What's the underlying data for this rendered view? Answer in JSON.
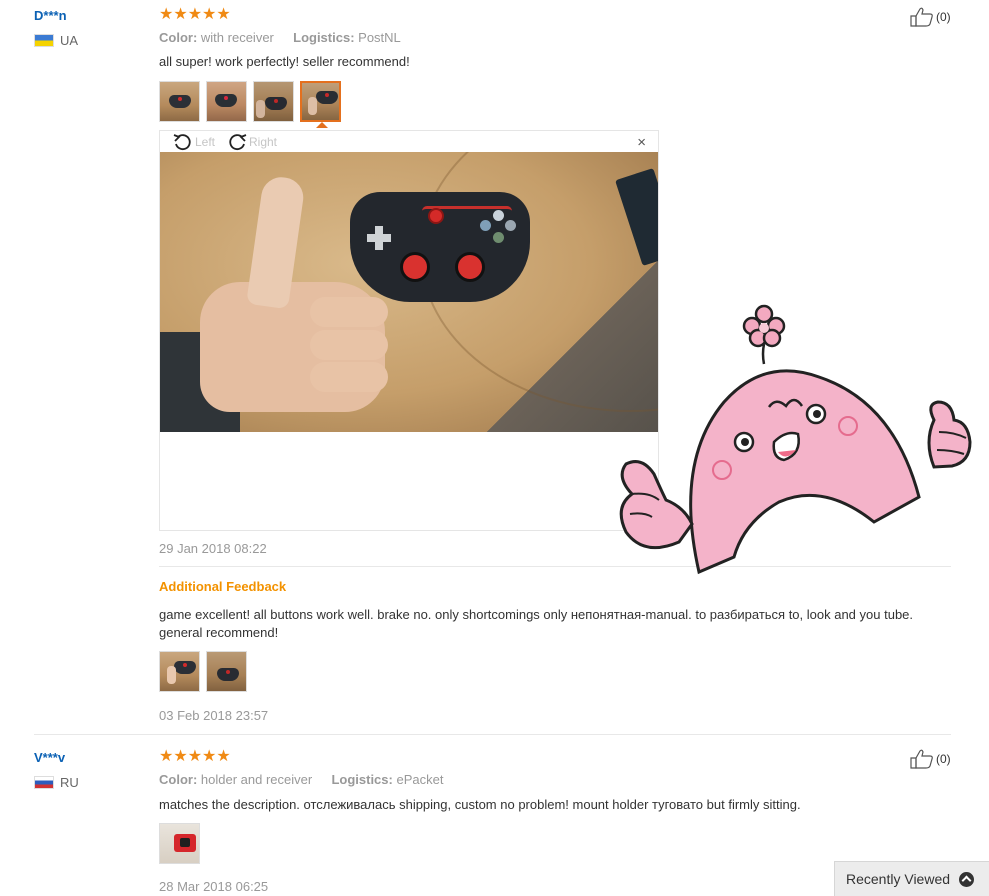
{
  "reviews": [
    {
      "user": "D***n",
      "country": "UA",
      "stars": "★★★★★",
      "rating": 5,
      "color_label": "Color:",
      "color_value": "with receiver",
      "logistics_label": "Logistics:",
      "logistics_value": "PostNL",
      "text": "all super! work perfectly! seller recommend!",
      "helpful_count": "(0)",
      "date": "29 Jan 2018 08:22",
      "viewer": {
        "rotate_left": "Left",
        "rotate_right": "Right",
        "close": "×"
      },
      "additional": {
        "title": "Additional Feedback",
        "text": "game excellent! all buttons work well. brake no. only shortcomings only непонятная-manual. to разбираться to, look and you tube. general recommend!",
        "date": "03 Feb 2018 23:57"
      }
    },
    {
      "user": "V***v",
      "country": "RU",
      "stars": "★★★★★",
      "rating": 5,
      "color_label": "Color:",
      "color_value": "holder and receiver",
      "logistics_label": "Logistics:",
      "logistics_value": "ePacket",
      "text": "matches the description. отслеживалась shipping, custom no problem! mount holder туговато but firmly sitting.",
      "helpful_count": "(0)",
      "date": "28 Mar 2018 06:25"
    }
  ],
  "recently_viewed": "Recently Viewed",
  "colors": {
    "accent": "#f39200",
    "star": "#f08a14",
    "link": "#0b61b4",
    "sticker_pink": "#f4b3c9"
  },
  "icons": [
    "thumbs-up-icon",
    "rotate-left-icon",
    "rotate-right-icon",
    "close-icon",
    "chevron-up-icon"
  ]
}
